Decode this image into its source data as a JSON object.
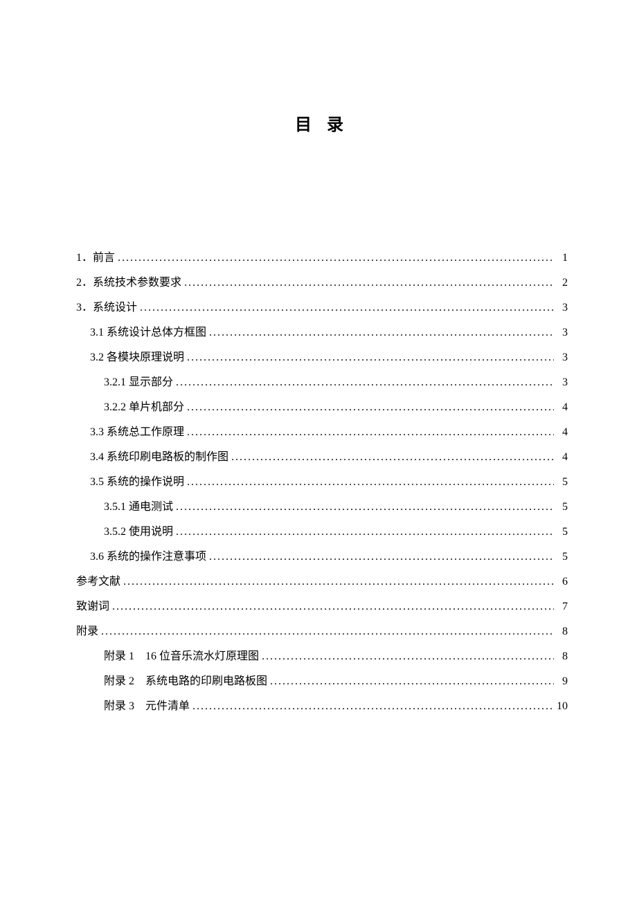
{
  "title": "目 录",
  "entries": [
    {
      "indent": 0,
      "label": "1．前言",
      "page": "1"
    },
    {
      "indent": 0,
      "label": "2．系统技术参数要求",
      "page": "2"
    },
    {
      "indent": 0,
      "label": "3．系统设计",
      "page": "3"
    },
    {
      "indent": 1,
      "label": "3.1 系统设计总体方框图",
      "page": "3"
    },
    {
      "indent": 1,
      "label": "3.2 各模块原理说明",
      "page": "3"
    },
    {
      "indent": 2,
      "label": "3.2.1 显示部分",
      "page": "3"
    },
    {
      "indent": 2,
      "label": "3.2.2 单片机部分",
      "page": "4"
    },
    {
      "indent": 1,
      "label": "3.3 系统总工作原理",
      "page": "4"
    },
    {
      "indent": 1,
      "label": "3.4 系统印刷电路板的制作图",
      "page": "4"
    },
    {
      "indent": 1,
      "label": "3.5 系统的操作说明",
      "page": "5"
    },
    {
      "indent": 2,
      "label": "3.5.1 通电测试",
      "page": "5"
    },
    {
      "indent": 2,
      "label": "3.5.2 使用说明",
      "page": "5"
    },
    {
      "indent": 1,
      "label": "3.6 系统的操作注意事项",
      "page": "5"
    },
    {
      "indent": 0,
      "label": "参考文献",
      "page": "6"
    },
    {
      "indent": 0,
      "label": "致谢词",
      "page": "7"
    },
    {
      "indent": 0,
      "label": "附录",
      "page": "8"
    },
    {
      "indent": 2,
      "label": "附录 1　16 位音乐流水灯原理图",
      "page": "8"
    },
    {
      "indent": 2,
      "label": "附录 2　系统电路的印刷电路板图",
      "page": "9"
    },
    {
      "indent": 2,
      "label": "附录 3　元件清单",
      "page": "10"
    }
  ]
}
